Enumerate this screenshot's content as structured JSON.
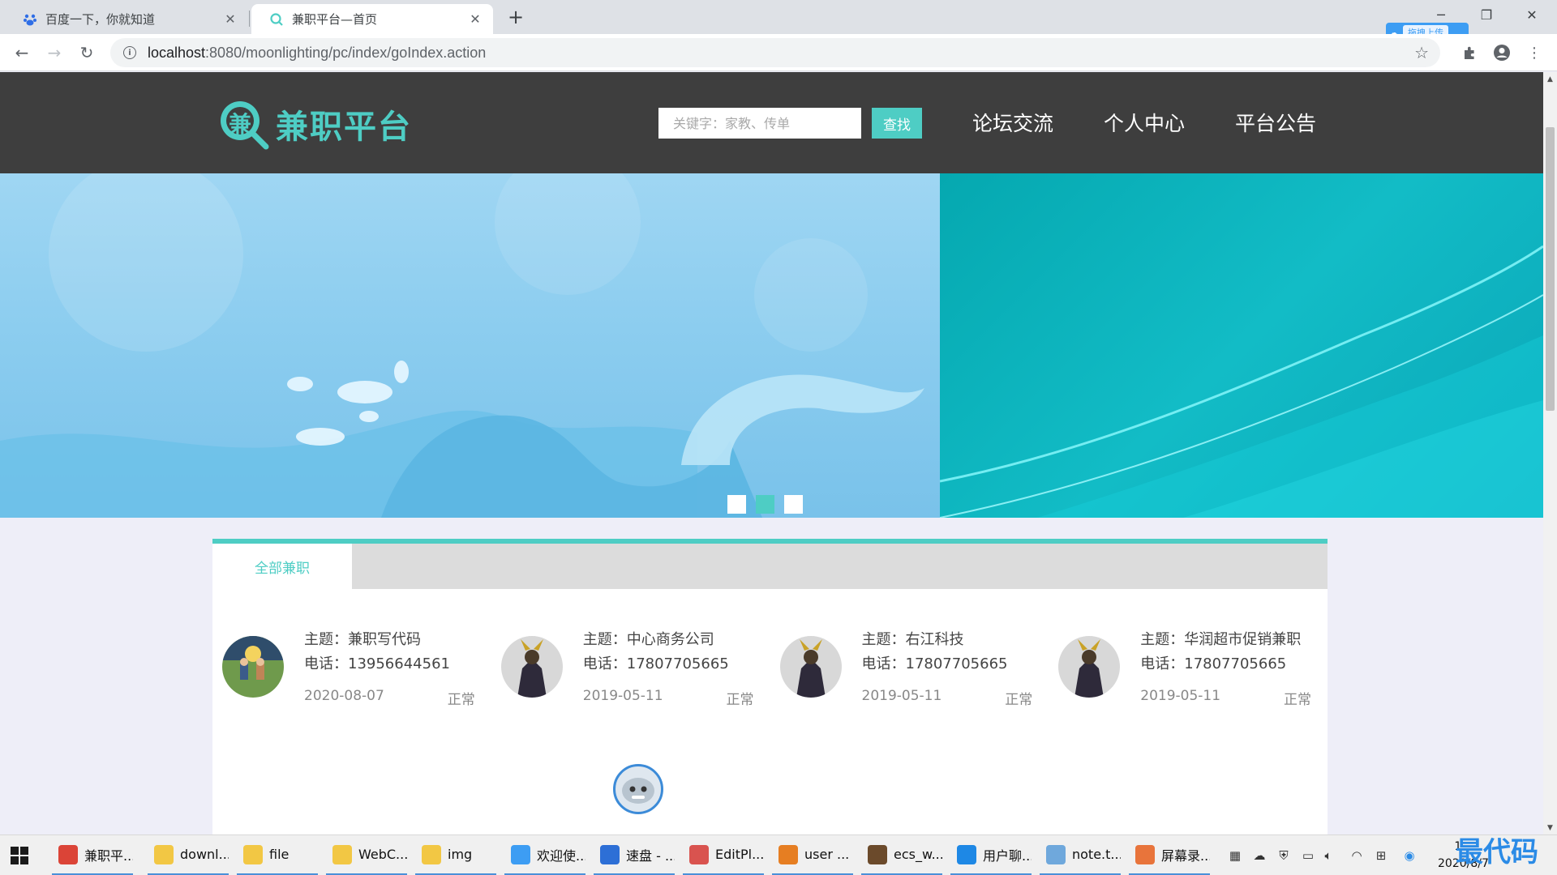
{
  "browser": {
    "tabs": [
      {
        "title": "百度一下，你就知道",
        "icon": "baidu-icon"
      },
      {
        "title": "兼职平台—首页",
        "icon": "search-q-icon",
        "active": true
      }
    ],
    "url_host": "localhost",
    "url_path": ":8080/moonlighting/pc/index/goIndex.action",
    "upload_badge": "拖拽上传"
  },
  "site": {
    "logo_char": "兼",
    "logo_text": "兼职平台",
    "search_placeholder": "关键字：家教、传单",
    "search_button": "查找",
    "nav": [
      "论坛交流",
      "个人中心",
      "平台公告"
    ]
  },
  "content": {
    "tab_all": "全部兼职",
    "jobs": [
      {
        "topic": "主题：兼职写代码",
        "phone": "电话：13956644561",
        "date": "2020-08-07",
        "status": "正常"
      },
      {
        "topic": "主题：中心商务公司",
        "phone": "电话：17807705665",
        "date": "2019-05-11",
        "status": "正常"
      },
      {
        "topic": "主题：右江科技",
        "phone": "电话：17807705665",
        "date": "2019-05-11",
        "status": "正常"
      },
      {
        "topic": "主题：华润超市促销兼职",
        "phone": "电话：17807705665",
        "date": "2019-05-11",
        "status": "正常"
      }
    ]
  },
  "taskbar": {
    "items": [
      {
        "label": "兼职平...",
        "icon": "chrome-icon",
        "color": "#db4437"
      },
      {
        "label": "downl...",
        "icon": "folder-icon",
        "color": "#f2c744"
      },
      {
        "label": "file",
        "icon": "folder-icon",
        "color": "#f2c744"
      },
      {
        "label": "WebC...",
        "icon": "folder-icon",
        "color": "#f2c744"
      },
      {
        "label": "img",
        "icon": "folder-icon",
        "color": "#f2c744"
      },
      {
        "label": "欢迎使...",
        "icon": "baidu-netdisk-icon",
        "color": "#3d9df3"
      },
      {
        "label": "速盘 - ...",
        "icon": "speedpan-icon",
        "color": "#2d6fd6"
      },
      {
        "label": "EditPl...",
        "icon": "editplus-icon",
        "color": "#d9534f"
      },
      {
        "label": "user ...",
        "icon": "app-ring-icon",
        "color": "#e67e22"
      },
      {
        "label": "ecs_w...",
        "icon": "ecs-icon",
        "color": "#6b4a2b"
      },
      {
        "label": "用户聊...",
        "icon": "ie-icon",
        "color": "#1e88e5"
      },
      {
        "label": "note.t...",
        "icon": "notepad-icon",
        "color": "#6fa8dc"
      },
      {
        "label": "屏幕录...",
        "icon": "recorder-icon",
        "color": "#e8743b"
      }
    ],
    "clock_time": "1...",
    "clock_date": "2020/8/7"
  },
  "watermark": "最代码",
  "colors": {
    "accent": "#4ecdc4",
    "header_bg": "#3e3e3e"
  }
}
